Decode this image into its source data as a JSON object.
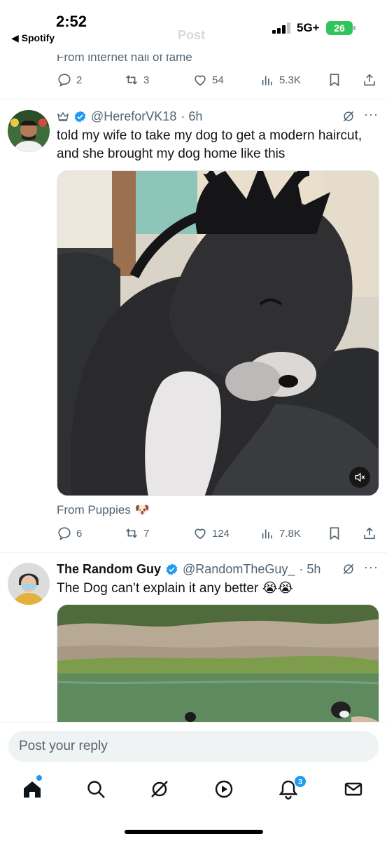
{
  "status_bar": {
    "time": "2:52",
    "back_app": "◀ Spotify",
    "faded_header_title": "Post",
    "network": "5G+",
    "battery": "26"
  },
  "previous_tweet": {
    "source": "From internet hall of fame",
    "replies": "2",
    "reposts": "3",
    "likes": "54",
    "views": "5.3K"
  },
  "tweet1": {
    "handle": "@HereforVK18",
    "time": "· 6h",
    "text": "told my wife to take my dog to get a modern haircut, and she brought my dog home like this",
    "media": "video",
    "source": "From Puppies",
    "source_emoji": "🐶",
    "replies": "6",
    "reposts": "7",
    "likes": "124",
    "views": "7.8K"
  },
  "tweet2": {
    "name": "The Random Guy",
    "handle": "@RandomTheGuy_",
    "time": "· 5h",
    "text": "The Dog can’t explain it any better 😭😭",
    "media": "video"
  },
  "reply_bar": {
    "placeholder": "Post your reply"
  },
  "tab_bar": {
    "items": [
      "home-icon",
      "search-icon",
      "grok-icon",
      "video-icon",
      "notifications-icon",
      "messages-icon"
    ],
    "notifications_count": "3"
  },
  "colors": {
    "accent": "#1d9bf0",
    "text_secondary": "#536471",
    "battery": "#30c55a"
  }
}
